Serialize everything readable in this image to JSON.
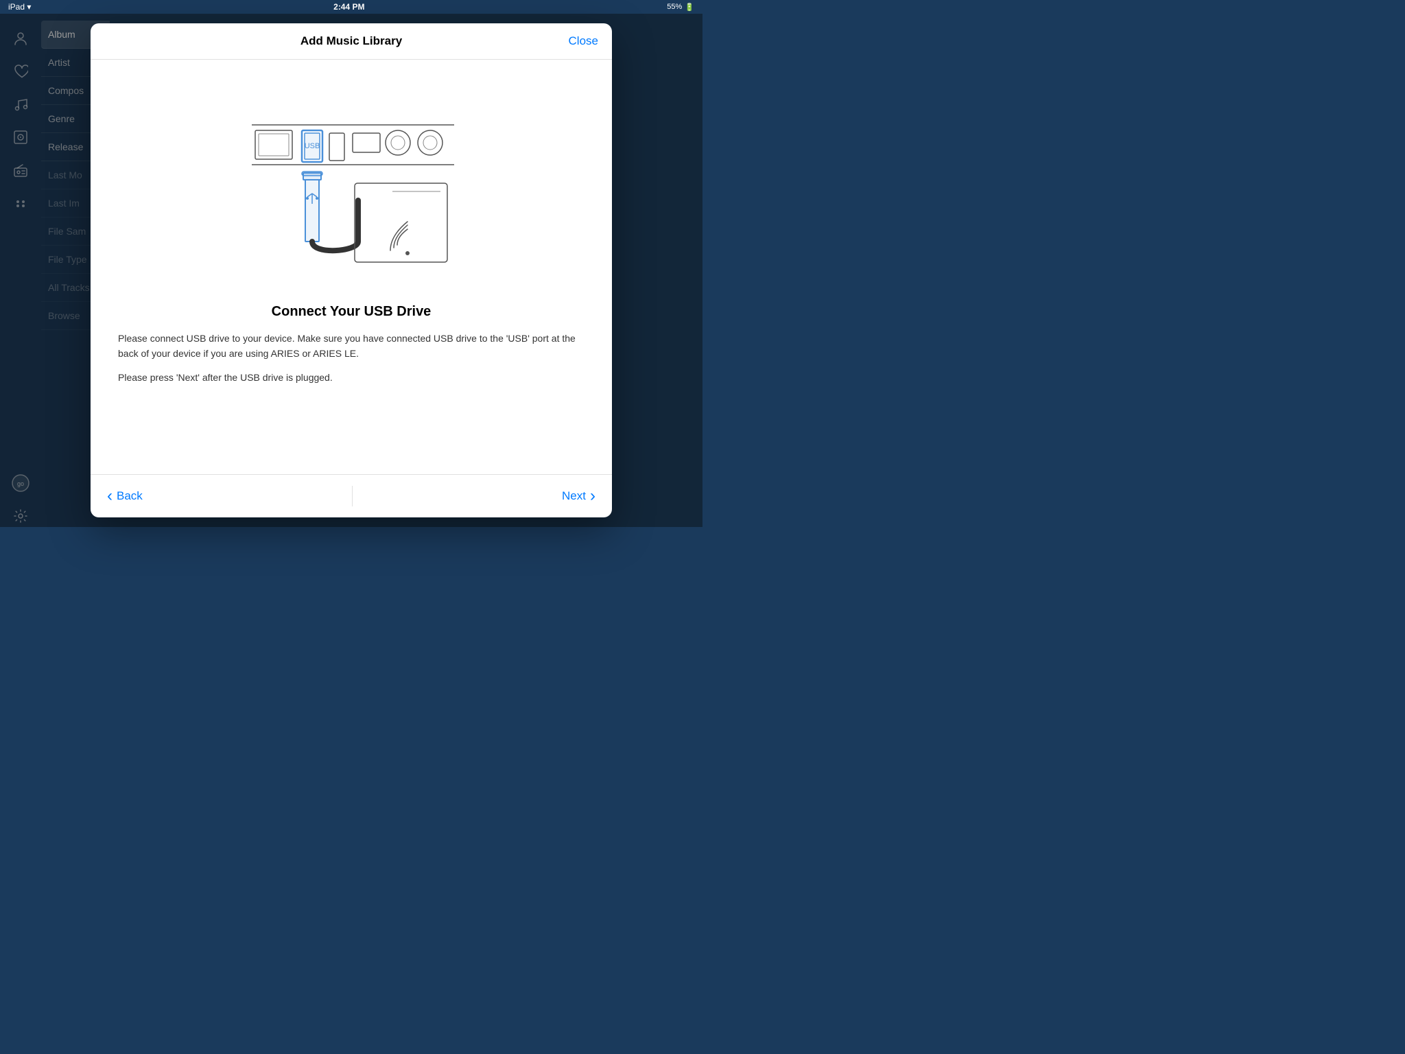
{
  "status_bar": {
    "left": "iPad ▾",
    "time": "2:44 PM",
    "battery": "55%"
  },
  "sidebar": {
    "icons": [
      {
        "name": "person-icon",
        "symbol": "👤"
      },
      {
        "name": "heart-icon",
        "symbol": "♡"
      },
      {
        "name": "music-icon",
        "symbol": "♬"
      },
      {
        "name": "album-art-icon",
        "symbol": "🖼"
      },
      {
        "name": "radio-icon",
        "symbol": "📻"
      },
      {
        "name": "dots-icon",
        "symbol": "⁘"
      },
      {
        "name": "logo-icon",
        "symbol": "◎"
      },
      {
        "name": "settings-icon",
        "symbol": "⚙"
      }
    ]
  },
  "nav_items": [
    {
      "label": "Album",
      "active": true
    },
    {
      "label": "Artist",
      "active": false
    },
    {
      "label": "Composer",
      "active": false
    },
    {
      "label": "Genre",
      "active": false
    },
    {
      "label": "Release",
      "active": false
    },
    {
      "label": "Last Mo",
      "active": false
    },
    {
      "label": "Last Im",
      "active": false
    },
    {
      "label": "File Sam",
      "active": false
    },
    {
      "label": "File Type",
      "active": false
    },
    {
      "label": "All Tracks",
      "active": false
    },
    {
      "label": "Browse",
      "active": false
    }
  ],
  "modal": {
    "title": "Add Music Library",
    "close_label": "Close",
    "heading": "Connect Your USB Drive",
    "description_1": "Please connect USB drive to your device. Make sure you have connected USB drive to the 'USB' port at the back of your device if you are using ARIES or ARIES LE.",
    "description_2": "Please press 'Next' after the USB drive is plugged.",
    "back_label": "Back",
    "next_label": "Next"
  },
  "colors": {
    "accent": "#007aff",
    "usb_highlight": "#4a90d9",
    "modal_bg": "#ffffff",
    "text_primary": "#000000",
    "text_secondary": "#333333"
  }
}
